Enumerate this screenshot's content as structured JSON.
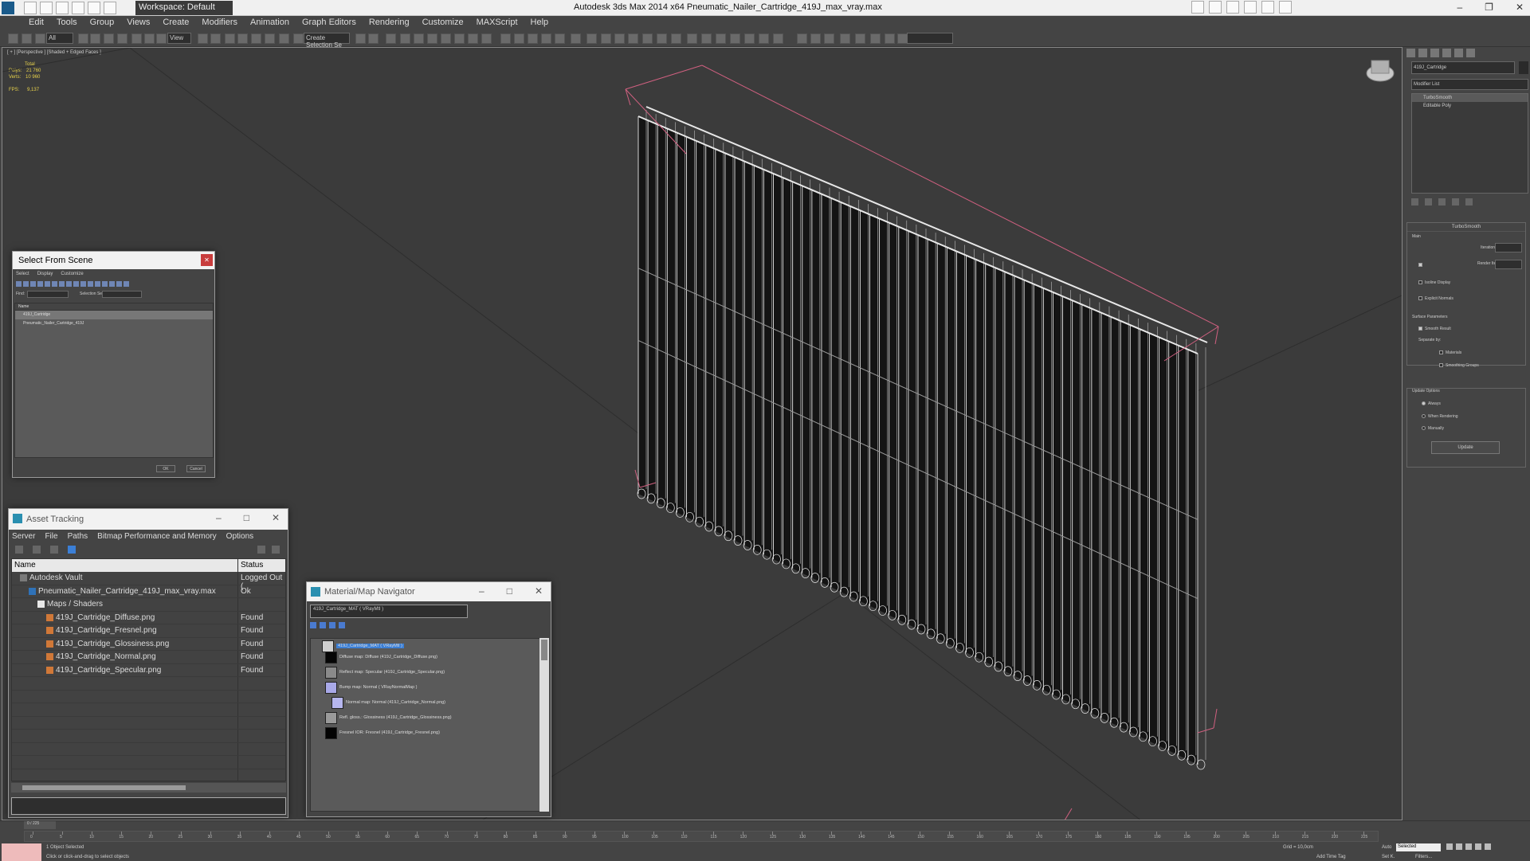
{
  "window": {
    "title": "Autodesk 3ds Max  2014 x64     Pneumatic_Nailer_Cartridge_419J_max_vray.max",
    "workspace": "Workspace: Default"
  },
  "menu": [
    "Edit",
    "Tools",
    "Group",
    "Views",
    "Create",
    "Modifiers",
    "Animation",
    "Graph Editors",
    "Rendering",
    "Customize",
    "MAXScript",
    "Help"
  ],
  "toolbar": {
    "filter_value": "All",
    "ref_coord": "View",
    "selection_set": "Create Selection Se"
  },
  "viewport": {
    "label": "[ + ] [Perspective ] [Shaded + Edged Faces ]",
    "stats": {
      "total_label": "Total",
      "polys_label": "Polys:",
      "polys": "21 760",
      "verts_label": "Verts:",
      "verts": "10 960",
      "fps_label": "FPS:",
      "fps": "9,137"
    }
  },
  "command_panel": {
    "object_name": "419J_Cartridge",
    "modifier_list": "Modifier List",
    "stack": [
      "TurboSmooth",
      "Editable Poly"
    ],
    "turbosmooth_title": "TurboSmooth",
    "main_label": "Main",
    "iterations_label": "Iterations:",
    "render_iters_label": "Render Iters:",
    "isoline_label": "Isoline Display",
    "explicit_normals_label": "Explicit Normals",
    "surface_params_label": "Surface Parameters",
    "smooth_result_label": "Smooth Result",
    "separate_by_label": "Separate by:",
    "materials_label": "Materials",
    "smoothing_groups_label": "Smoothing Groups",
    "update_options_label": "Update Options",
    "always_label": "Always",
    "when_rendering_label": "When Rendering",
    "manually_label": "Manually",
    "update_button": "Update"
  },
  "select_from_scene": {
    "title": "Select From Scene",
    "menu": [
      "Select",
      "Display",
      "Customize"
    ],
    "find_label": "Find:",
    "selection_set_label": "Selection Set:",
    "column_name": "Name",
    "rows": [
      "419J_Cartridge",
      "Pneumatic_Nailer_Cartridge_419J"
    ],
    "ok": "OK",
    "cancel": "Cancel"
  },
  "asset_tracking": {
    "title": "Asset Tracking",
    "menu": [
      "Server",
      "File",
      "Paths",
      "Bitmap Performance and Memory",
      "Options"
    ],
    "columns": [
      "Name",
      "Status"
    ],
    "rows": [
      {
        "name": "Autodesk Vault",
        "status": "Logged Out (",
        "indent": 0
      },
      {
        "name": "Pneumatic_Nailer_Cartridge_419J_max_vray.max",
        "status": "Ok",
        "indent": 1
      },
      {
        "name": "Maps / Shaders",
        "status": "",
        "indent": 2
      },
      {
        "name": "419J_Cartridge_Diffuse.png",
        "status": "Found",
        "indent": 3
      },
      {
        "name": "419J_Cartridge_Fresnel.png",
        "status": "Found",
        "indent": 3
      },
      {
        "name": "419J_Cartridge_Glossiness.png",
        "status": "Found",
        "indent": 3
      },
      {
        "name": "419J_Cartridge_Normal.png",
        "status": "Found",
        "indent": 3
      },
      {
        "name": "419J_Cartridge_Specular.png",
        "status": "Found",
        "indent": 3
      }
    ]
  },
  "material_navigator": {
    "title": "Material/Map Navigator",
    "field": "419J_Cartridge_MAT  ( VRayMtl )",
    "nodes": [
      {
        "label": "419J_Cartridge_MAT  ( VRayMtl )",
        "swatch": "#cfcfcf"
      },
      {
        "label": "Diffuse map: Diffuse (419J_Cartridge_Diffuse.png)",
        "swatch": "#050505"
      },
      {
        "label": "Reflect map: Specular (419J_Cartridge_Specular.png)",
        "swatch": "#8a8a8a"
      },
      {
        "label": "Bump map: Normal  ( VRayNormalMap )",
        "swatch": "#a9a9e8"
      },
      {
        "label": "Normal map: Normal (419J_Cartridge_Normal.png)",
        "swatch": "#b6b6ee"
      },
      {
        "label": "Refl. gloss.: Glossiness (419J_Cartridge_Glossiness.png)",
        "swatch": "#9a9a9a"
      },
      {
        "label": "Fresnel IOR: Fresnel (419J_Cartridge_Fresnel.png)",
        "swatch": "#030303"
      }
    ]
  },
  "status": {
    "frame": "0 / 225",
    "objects": "1 Object Selected",
    "hint": "Click or click-and-drag to select objects",
    "grid": "Grid = 10,0cm",
    "add_time_tag": "Add Time Tag",
    "key_mode": "Selected",
    "set_key": "Set K.",
    "filters": "Filters...",
    "auto": "Auto"
  },
  "ruler_ticks": [
    "0",
    "5",
    "10",
    "15",
    "20",
    "25",
    "30",
    "35",
    "40",
    "45",
    "50",
    "55",
    "60",
    "65",
    "70",
    "75",
    "80",
    "85",
    "90",
    "95",
    "100",
    "105",
    "110",
    "115",
    "120",
    "125",
    "130",
    "135",
    "140",
    "145",
    "150",
    "155",
    "160",
    "165",
    "170",
    "175",
    "180",
    "185",
    "190",
    "195",
    "200",
    "205",
    "210",
    "215",
    "220",
    "225"
  ],
  "colors": {
    "viewport_bg": "#3b3b3b",
    "wire": "#e8e8e8",
    "bbox": "#d06080",
    "stats": "#e8d24a",
    "close_red": "#c83c3c"
  }
}
